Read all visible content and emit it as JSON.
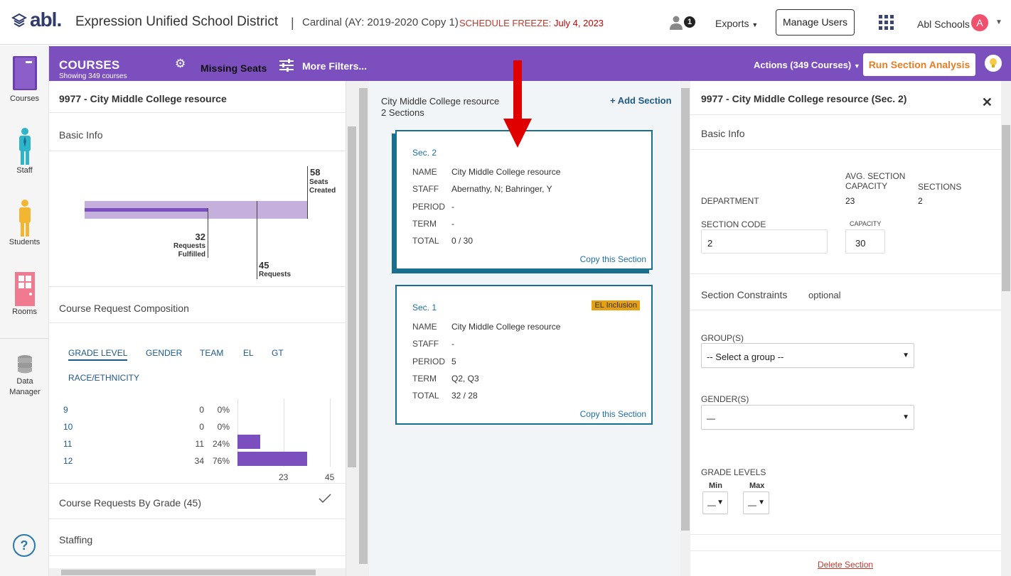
{
  "topbar": {
    "logo": "abl.",
    "district": "Expression Unified School District",
    "separator": "|",
    "school": "Cardinal (AY: 2019-2020 Copy 1)",
    "freeze_label": "SCHEDULE FREEZE:",
    "freeze_date": "July 4, 2023",
    "notification_count": "1",
    "exports": "Exports",
    "manage_users": "Manage Users",
    "account": "Abl Schools",
    "avatar_letter": "A"
  },
  "nav": [
    {
      "label": "Courses"
    },
    {
      "label": "Staff"
    },
    {
      "label": "Students"
    },
    {
      "label": "Rooms"
    },
    {
      "label": "Data Manager"
    }
  ],
  "toolbar": {
    "title": "COURSES",
    "subtitle": "Showing 349 courses",
    "missing_seats": "Missing Seats",
    "more_filters": "More Filters...",
    "actions": "Actions (349 Courses)",
    "run_analysis": "Run Section Analysis"
  },
  "course": {
    "heading": "9977 - City Middle College resource",
    "basic_info": "Basic Info",
    "seats_created": "58",
    "seats_created_label": "Seats Created",
    "requests_fulfilled": "32",
    "requests_fulfilled_label": "Requests Fulfilled",
    "requests": "45",
    "requests_label": "Requests",
    "composition_title": "Course Request Composition",
    "tabs": [
      "GRADE LEVEL",
      "GENDER",
      "TEAM",
      "EL",
      "GT",
      "RACE/ETHNICITY"
    ],
    "grades": [
      {
        "grade": "9",
        "count": "0",
        "pct": "0%",
        "value": 0
      },
      {
        "grade": "10",
        "count": "0",
        "pct": "0%",
        "value": 0
      },
      {
        "grade": "11",
        "count": "11",
        "pct": "24%",
        "value": 11
      },
      {
        "grade": "12",
        "count": "34",
        "pct": "76%",
        "value": 34
      }
    ],
    "axis_mid": "23",
    "axis_max": "45",
    "by_grade": "Course Requests By Grade (45)",
    "staffing": "Staffing"
  },
  "sections_panel": {
    "course_name": "City Middle College resource",
    "count": "2 Sections",
    "add_section": "+ Add Section",
    "cards": [
      {
        "sec": "Sec. 2",
        "name_k": "NAME",
        "name": "City Middle College resource",
        "staff_k": "STAFF",
        "staff": "Abernathy, N; Bahringer, Y",
        "period_k": "PERIOD",
        "period": "-",
        "term_k": "TERM",
        "term": "-",
        "total_k": "TOTAL",
        "total": "0 / 30",
        "copy": "Copy this Section"
      },
      {
        "sec": "Sec. 1",
        "badge": "EL Inclusion",
        "name_k": "NAME",
        "name": "City Middle College resource",
        "staff_k": "STAFF",
        "staff": "-",
        "period_k": "PERIOD",
        "period": "5",
        "term_k": "TERM",
        "term": "Q2, Q3",
        "total_k": "TOTAL",
        "total": "32 / 28",
        "copy": "Copy this Section"
      }
    ]
  },
  "detail": {
    "heading": "9977 - City Middle College resource (Sec. 2)",
    "basic_info": "Basic Info",
    "avg_capacity_label": "AVG. SECTION CAPACITY",
    "sections_label": "SECTIONS",
    "department_label": "DEPARTMENT",
    "avg_capacity": "23",
    "sections": "2",
    "section_code_label": "SECTION CODE",
    "section_code": "2",
    "capacity_label": "CAPACITY",
    "capacity": "30",
    "constraints": "Section Constraints",
    "optional": "optional",
    "groups_label": "GROUP(S)",
    "groups_value": "-- Select a group --",
    "gender_label": "GENDER(S)",
    "gender_value": "—",
    "grade_levels_label": "GRADE LEVELS",
    "min_label": "Min",
    "max_label": "Max",
    "min_value": "—",
    "max_value": "—",
    "delete": "Delete Section"
  },
  "colors": {
    "purple": "#7b4fbd",
    "teal": "#1a6e8e",
    "orange": "#e67e22",
    "red_arrow": "#e00000"
  }
}
